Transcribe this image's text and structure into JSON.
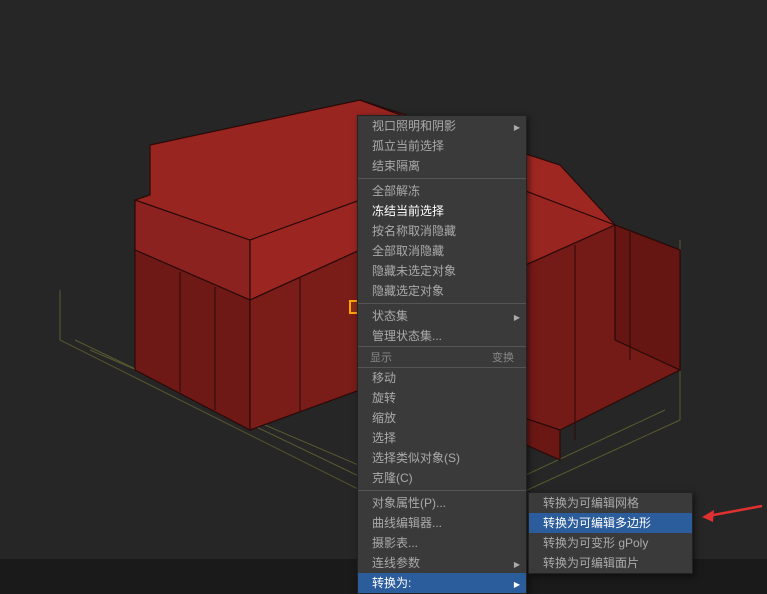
{
  "menu": {
    "items": [
      {
        "label": "视口照明和阴影",
        "arrow": true
      },
      {
        "label": "孤立当前选择"
      },
      {
        "label": "结束隔离"
      },
      {
        "sep": true
      },
      {
        "label": "全部解冻"
      },
      {
        "label": "冻结当前选择",
        "active": true
      },
      {
        "label": "按名称取消隐藏"
      },
      {
        "label": "全部取消隐藏"
      },
      {
        "label": "隐藏未选定对象"
      },
      {
        "label": "隐藏选定对象"
      },
      {
        "sep": true
      },
      {
        "label": "状态集",
        "arrow": true
      },
      {
        "label": "管理状态集..."
      }
    ],
    "header": {
      "left": "显示",
      "right": "变换"
    },
    "items2": [
      {
        "label": "移动"
      },
      {
        "label": "旋转"
      },
      {
        "label": "缩放"
      },
      {
        "label": "选择"
      },
      {
        "label": "选择类似对象(S)"
      },
      {
        "label": "克隆(C)"
      },
      {
        "sep": true
      },
      {
        "label": "对象属性(P)..."
      },
      {
        "label": "曲线编辑器..."
      },
      {
        "label": "摄影表..."
      },
      {
        "label": "连线参数",
        "arrow": true
      },
      {
        "label": "转换为:",
        "arrow": true,
        "highlight": true
      }
    ]
  },
  "submenu": {
    "items": [
      {
        "label": "转换为可编辑网格"
      },
      {
        "label": "转换为可编辑多边形",
        "highlight": true
      },
      {
        "label": "转换为可变形 gPoly"
      },
      {
        "label": "转换为可编辑面片"
      }
    ]
  }
}
